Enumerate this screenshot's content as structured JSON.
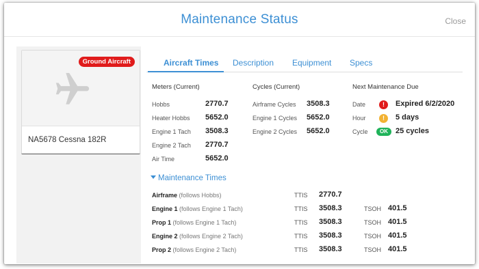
{
  "modal": {
    "title": "Maintenance Status",
    "close_label": "Close"
  },
  "aircraft": {
    "badge": "Ground Aircraft",
    "name": "NA5678 Cessna 182R",
    "icon": "airplane-icon"
  },
  "tabs": [
    "Aircraft Times",
    "Description",
    "Equipment",
    "Specs"
  ],
  "meters": {
    "heading": "Meters (Current)",
    "rows": [
      {
        "label": "Hobbs",
        "value": "2770.7"
      },
      {
        "label": "Heater Hobbs",
        "value": "5652.0"
      },
      {
        "label": "Engine 1 Tach",
        "value": "3508.3"
      },
      {
        "label": "Engine 2 Tach",
        "value": "2770.7"
      },
      {
        "label": "Air Time",
        "value": "5652.0"
      }
    ]
  },
  "cycles": {
    "heading": "Cycles (Current)",
    "rows": [
      {
        "label": "Airframe Cycles",
        "value": "3508.3"
      },
      {
        "label": "Engine 1 Cycles",
        "value": "5652.0"
      },
      {
        "label": "Engine 2 Cycles",
        "value": "5652.0"
      }
    ]
  },
  "next_due": {
    "heading": "Next Maintenance Due",
    "rows": [
      {
        "label": "Date",
        "status": "!",
        "status_color": "#e01b1b",
        "value": "Expired 6/2/2020"
      },
      {
        "label": "Hour",
        "status": "!",
        "status_color": "#f2b233",
        "value": "5 days"
      },
      {
        "label": "Cycle",
        "status": "OK",
        "status_color": "#1fb35a",
        "value": "25 cycles"
      }
    ]
  },
  "maintenance_times": {
    "toggle_label": "Maintenance Times",
    "ttis_label": "TTIS",
    "tsoh_label": "TSOH",
    "rows": [
      {
        "name": "Airframe",
        "follows": "(follows Hobbs)",
        "ttis": "2770.7",
        "tsoh": ""
      },
      {
        "name": "Engine 1",
        "follows": "(follows Engine 1 Tach)",
        "ttis": "3508.3",
        "tsoh": "401.5"
      },
      {
        "name": "Prop 1",
        "follows": "(follows Engine 1 Tach)",
        "ttis": "3508.3",
        "tsoh": "401.5"
      },
      {
        "name": "Engine 2",
        "follows": "(follows Engine 2 Tach)",
        "ttis": "3508.3",
        "tsoh": "401.5"
      },
      {
        "name": "Prop 2",
        "follows": "(follows Engine 2 Tach)",
        "ttis": "3508.3",
        "tsoh": "401.5"
      }
    ]
  },
  "colors": {
    "accent": "#3c8fd4",
    "danger": "#e01b1b",
    "warning": "#f2b233",
    "success": "#1fb35a"
  }
}
